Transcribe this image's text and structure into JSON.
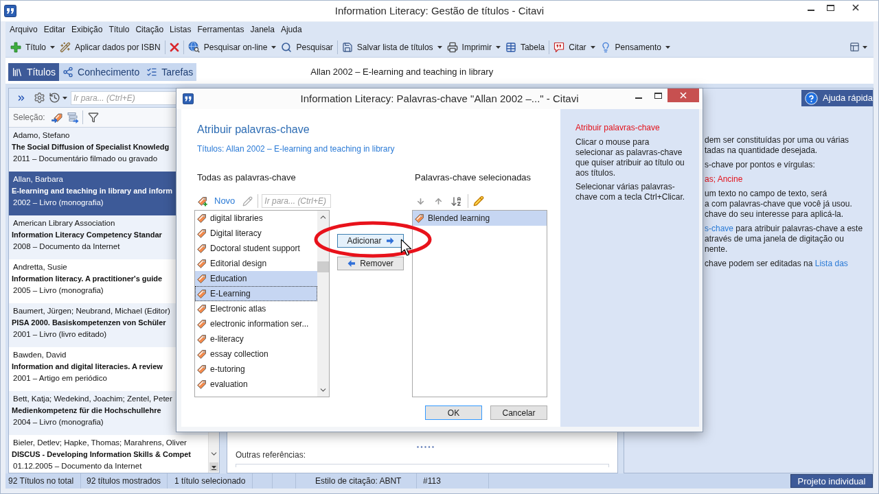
{
  "window": {
    "title": "Information Literacy: Gestão de títulos - Citavi"
  },
  "menu": [
    "Arquivo",
    "Editar",
    "Exibição",
    "Título",
    "Citação",
    "Listas",
    "Ferramentas",
    "Janela",
    "Ajuda"
  ],
  "toolbar": [
    {
      "items": [
        {
          "kind": "button",
          "label": "Título",
          "dropdown": true
        },
        {
          "kind": "button",
          "label": "Aplicar dados por ISBN",
          "dropdown": false
        }
      ]
    },
    {
      "items": [
        {
          "kind": "icon",
          "dropdown": false
        }
      ]
    },
    {
      "items": [
        {
          "kind": "button",
          "label": "Pesquisar on-line",
          "dropdown": true
        },
        {
          "kind": "button",
          "label": "Pesquisar",
          "dropdown": false
        }
      ]
    },
    {
      "items": [
        {
          "kind": "button",
          "label": "Salvar lista de títulos",
          "dropdown": true
        },
        {
          "kind": "button",
          "label": "Imprimir",
          "dropdown": true
        },
        {
          "kind": "button",
          "label": "Tabela",
          "dropdown": false
        }
      ]
    },
    {
      "items": [
        {
          "kind": "button",
          "label": "Citar",
          "dropdown": true
        },
        {
          "kind": "button",
          "label": "Pensamento",
          "dropdown": true
        }
      ]
    }
  ],
  "view_tabs": [
    {
      "label": "Títulos",
      "selected": true
    },
    {
      "label": "Conhecimento",
      "selected": false
    },
    {
      "label": "Tarefas",
      "selected": false
    }
  ],
  "current_title": "Allan 2002 – E-learning and teaching in library",
  "reference_panel": {
    "search": {
      "placeholder": "Ir para... (Ctrl+E)"
    },
    "selection_label": "Seleção:",
    "references": [
      {
        "authors": "Adamo, Stefano",
        "title": "The Social Diffusion of Specialist Knowledg",
        "info": "2011 – Documentário filmado ou gravado",
        "selected": false
      },
      {
        "authors": "Allan, Barbara",
        "title": "E-learning and teaching in library and inform",
        "info": "2002 – Livro (monografia)",
        "selected": true
      },
      {
        "authors": "American Library Association",
        "title": "Information Literacy Competency Standar",
        "info": "2008 – Documento da Internet",
        "selected": false
      },
      {
        "authors": "Andretta, Susie",
        "title": "Information literacy. A practitioner's guide",
        "info": "2005 – Livro (monografia)",
        "selected": false
      },
      {
        "authors": "Baumert, Jürgen; Neubrand, Michael (Editor)",
        "title": "PISA 2000. Basiskompetenzen von Schüler",
        "info": "2001 – Livro (livro editado)",
        "selected": false
      },
      {
        "authors": "Bawden, David",
        "title": "Information and digital literacies. A review",
        "info": "2001 – Artigo em periódico",
        "selected": false
      },
      {
        "authors": "Bett, Katja; Wedekind, Joachim; Zentel, Peter",
        "title": "Medienkompetenz für die Hochschullehre",
        "info": "2004 – Livro (monografia)",
        "selected": false
      },
      {
        "authors": "Bieler, Detlev; Hapke, Thomas; Marahrens, Oliver",
        "title": "DISCUS - Developing Information Skills & Compet",
        "info": "01.12.2005 – Documento da Internet",
        "selected": false
      }
    ]
  },
  "center_panel": {
    "field_label": "Outras referências:"
  },
  "help_panel": {
    "button": "Ajuda rápida",
    "paragraphs": [
      {
        "lines": [
          [
            {
              "kind": "text",
              "text": "dem ser constituídas por uma ou várias"
            }
          ],
          [
            {
              "kind": "text",
              "text": "tadas na quantidade desejada."
            }
          ]
        ]
      },
      {
        "lines": [
          [
            {
              "kind": "text",
              "text": "s-chave por pontos e vírgulas:"
            }
          ]
        ]
      },
      {
        "lines": [
          [
            {
              "kind": "example",
              "text": "as; Ancine"
            }
          ]
        ]
      },
      {
        "lines": [
          [
            {
              "kind": "text",
              "text": "um texto no campo de texto, será"
            }
          ],
          [
            {
              "kind": "text",
              "text": "a com palavras-chave que você já usou."
            }
          ],
          [
            {
              "kind": "text",
              "text": "chave do seu interesse para aplicá-la."
            }
          ]
        ]
      },
      {
        "lines": [
          [
            {
              "kind": "link",
              "text": "s-chave"
            },
            {
              "kind": "text",
              "text": " para atribuir palavras-chave a este"
            }
          ],
          [
            {
              "kind": "text",
              "text": "através de uma janela de digitação ou"
            }
          ],
          [
            {
              "kind": "text",
              "text": "nente."
            }
          ]
        ]
      },
      {
        "lines": [
          [
            {
              "kind": "text",
              "text": "chave podem ser editadas na "
            },
            {
              "kind": "link",
              "text": "Lista das"
            }
          ]
        ]
      }
    ]
  },
  "dialog": {
    "title": "Information Literacy: Palavras-chave \"Allan 2002 –...\" - Citavi",
    "heading": "Atribuir palavras-chave",
    "titles_link": "Títulos: Allan 2002 – E-learning and teaching in library",
    "all_keywords": {
      "label": "Todas as palavras-chave",
      "new_button": "Novo",
      "search": {
        "placeholder": "Ir para... (Ctrl+E)"
      },
      "items": [
        {
          "label": "digital libraries",
          "selected": false,
          "focused": false
        },
        {
          "label": "Digital literacy",
          "selected": false,
          "focused": false
        },
        {
          "label": "Doctoral student support",
          "selected": false,
          "focused": false
        },
        {
          "label": "Editorial design",
          "selected": false,
          "focused": false
        },
        {
          "label": "Education",
          "selected": true,
          "focused": false
        },
        {
          "label": "E-Learning",
          "selected": true,
          "focused": true
        },
        {
          "label": "Electronic atlas",
          "selected": false,
          "focused": false
        },
        {
          "label": "electronic information ser...",
          "selected": false,
          "focused": false
        },
        {
          "label": "e-literacy",
          "selected": false,
          "focused": false
        },
        {
          "label": "essay collection",
          "selected": false,
          "focused": false
        },
        {
          "label": "e-tutoring",
          "selected": false,
          "focused": false
        },
        {
          "label": "evaluation",
          "selected": false,
          "focused": false
        }
      ]
    },
    "transfer_buttons": [
      {
        "kind": "add",
        "label": "Adicionar",
        "hover": true
      },
      {
        "kind": "remove",
        "label": "Remover",
        "hover": false
      }
    ],
    "selected_keywords": {
      "label": "Palavras-chave selecionadas",
      "items": [
        {
          "label": "Blended learning",
          "selected": true
        }
      ]
    },
    "buttons": [
      {
        "label": "OK",
        "default": true
      },
      {
        "label": "Cancelar",
        "default": false
      }
    ],
    "help": {
      "heading": "Atribuir palavras-chave",
      "paragraphs": [
        "Clicar o mouse para selecionar as palavras-chave que quiser atribuir ao título ou aos títulos.",
        "Selecionar várias palavras-chave com a tecla Ctrl+Clicar."
      ]
    }
  },
  "status_bar": {
    "items": [
      "92 Títulos no total",
      "92 títulos mostrados",
      "1 título selecionado",
      "Estilo de citação: ABNT",
      "#113"
    ],
    "project_button": "Projeto individual"
  }
}
